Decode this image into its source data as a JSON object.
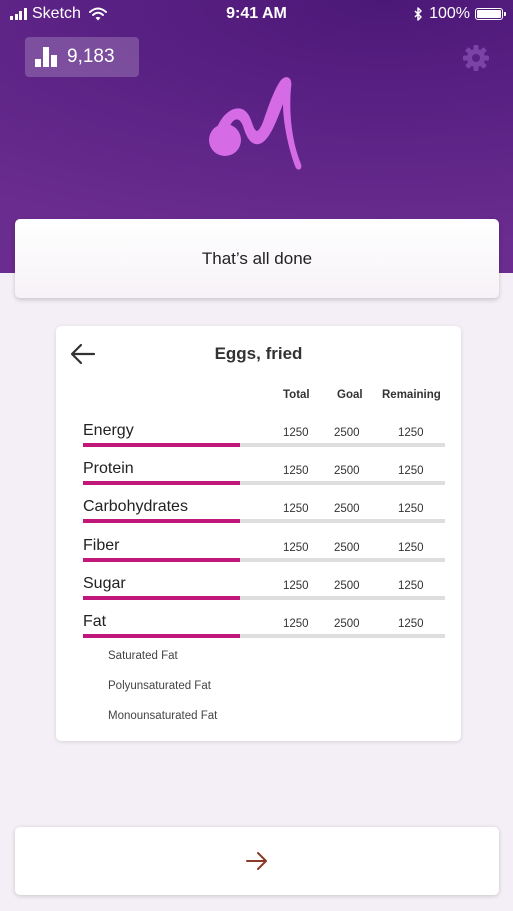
{
  "status_bar": {
    "carrier": "Sketch",
    "time": "9:41 AM",
    "battery": "100%"
  },
  "header": {
    "step_count": "9,183"
  },
  "done_card": {
    "text": "That’s all done"
  },
  "nutrition": {
    "title": "Eggs, fried",
    "columns": [
      "Total",
      "Goal",
      "Remaining"
    ],
    "rows": [
      {
        "name": "Energy",
        "total": "1250",
        "goal": "2500",
        "remaining": "1250",
        "progress": 0.5
      },
      {
        "name": "Protein",
        "total": "1250",
        "goal": "2500",
        "remaining": "1250",
        "progress": 0.5
      },
      {
        "name": "Carbohydrates",
        "total": "1250",
        "goal": "2500",
        "remaining": "1250",
        "progress": 0.5
      },
      {
        "name": "Fiber",
        "total": "1250",
        "goal": "2500",
        "remaining": "1250",
        "progress": 0.5
      },
      {
        "name": "Sugar",
        "total": "1250",
        "goal": "2500",
        "remaining": "1250",
        "progress": 0.5
      },
      {
        "name": "Fat",
        "total": "1250",
        "goal": "2500",
        "remaining": "1250",
        "progress": 0.5
      }
    ],
    "fat_breakdown": [
      "Saturated Fat",
      "Polyunsaturated Fat",
      "Monounsaturated Fat"
    ]
  },
  "colors": {
    "header": "#5a2184",
    "accent": "#c2177a",
    "logo": "#d66be6",
    "next_arrow": "#8b3a2a"
  },
  "icons": {
    "steps": "bar-chart-icon",
    "settings": "gear-icon",
    "back": "arrow-left-icon",
    "next": "arrow-right-icon",
    "logo": "brand-logo"
  }
}
